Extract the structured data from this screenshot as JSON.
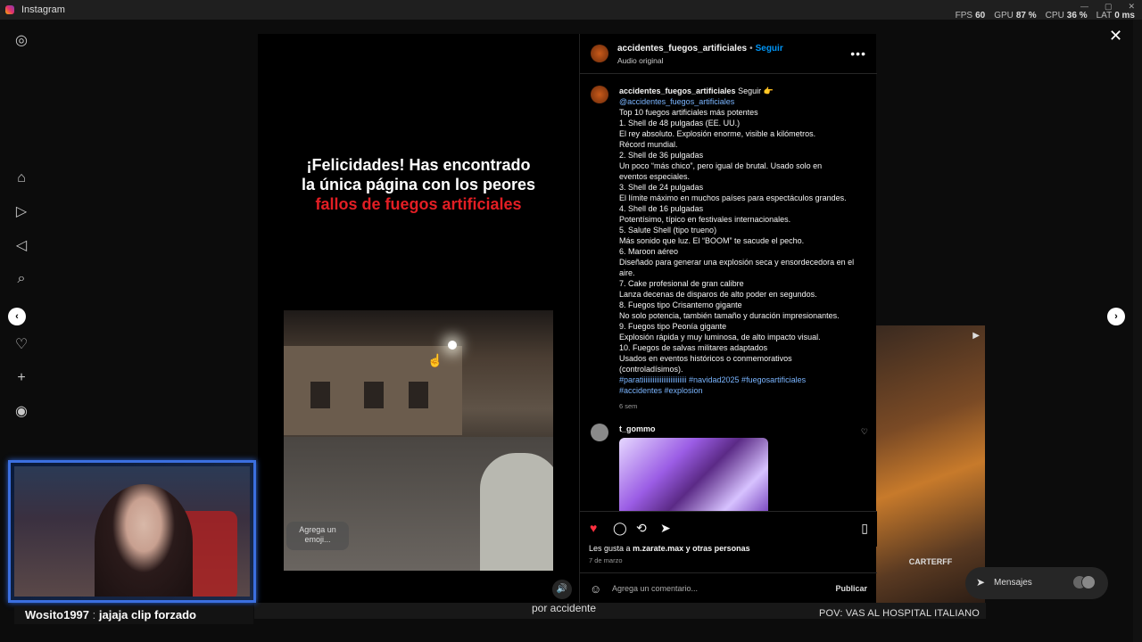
{
  "window": {
    "title": "Instagram"
  },
  "stats": {
    "fps_label": "FPS",
    "fps": "60",
    "gpu_label": "GPU",
    "gpu": "87 %",
    "cpu_label": "CPU",
    "cpu": "36 %",
    "lat_label": "LAT",
    "lat": "0 ms"
  },
  "rail": {
    "icons": [
      "instagram-icon",
      "home-icon",
      "reels-icon",
      "explore-icon",
      "search-icon",
      "notifications-icon",
      "create-icon",
      "profile-icon"
    ]
  },
  "video": {
    "headline_line1": "¡Felicidades! Has encontrado",
    "headline_line2": "la única página con los peores",
    "headline_line3": "fallos de fuegos artificiales",
    "emoji_prompt": "Agrega un emoji..."
  },
  "post": {
    "username": "accidentes_fuegos_artificiales",
    "follow": "Seguir",
    "audio": "Audio original",
    "caption_follow": "Seguir 👉",
    "caption_mention": "@accidentes_fuegos_artificiales",
    "caption_lines": [
      "Top 10 fuegos artificiales más potentes",
      "1. Shell de 48 pulgadas (EE. UU.)",
      "El rey absoluto. Explosión enorme, visible a kilómetros.",
      "Récord mundial.",
      "2. Shell de 36 pulgadas",
      "Un poco “más chico”, pero igual de brutal. Usado solo en",
      "eventos especiales.",
      "3. Shell de 24 pulgadas",
      "El límite máximo en muchos países para espectáculos grandes.",
      "4. Shell de 16 pulgadas",
      "Potentísimo, típico en festivales internacionales.",
      "5. Salute Shell (tipo trueno)",
      "Más sonido que luz. El “BOOM” te sacude el pecho.",
      "6. Maroon aéreo",
      "Diseñado para generar una explosión seca y ensordecedora en el",
      "aire.",
      "7. Cake profesional de gran calibre",
      "Lanza decenas de disparos de alto poder en segundos.",
      "8. Fuegos tipo Crisantemo gigante",
      "No solo potencia, también tamaño y duración impresionantes.",
      "9. Fuegos tipo Peonía gigante",
      "Explosión rápida y muy luminosa, de alto impacto visual.",
      "10. Fuegos de salvas militares adaptados",
      "Usados en eventos históricos o conmemorativos",
      "(controladísimos)."
    ],
    "hashtags_line1": "#paratiiiiiiiiiiiiiiiiiiiiiiiii #navidad2025 #fuegosartificiales",
    "hashtags_line2": "#accidentes #explosion",
    "caption_time": "6 sem",
    "comment_user": "t_gommo",
    "likes_prefix": "Les gusta a",
    "likes_user": "m.zarate.max",
    "likes_suffix": "y otras personas",
    "date": "7 de marzo",
    "comment_placeholder": "Agrega un comentario...",
    "publish": "Publicar"
  },
  "messages": {
    "label": "Mensajes"
  },
  "background": {
    "caption_1": "por accidente",
    "caption_2": "POV: VAS AL HOSPITAL ITALIANO",
    "watermark": "CARTERFF"
  },
  "stream": {
    "chat_user": "Wosito1997",
    "chat_sep": ":",
    "chat_text": "jajaja clip forzado"
  },
  "colors": {
    "accent": "#0095f6",
    "like": "#ff3040",
    "headline_red": "#e31e24",
    "webcam_border": "#3b6fe0"
  }
}
